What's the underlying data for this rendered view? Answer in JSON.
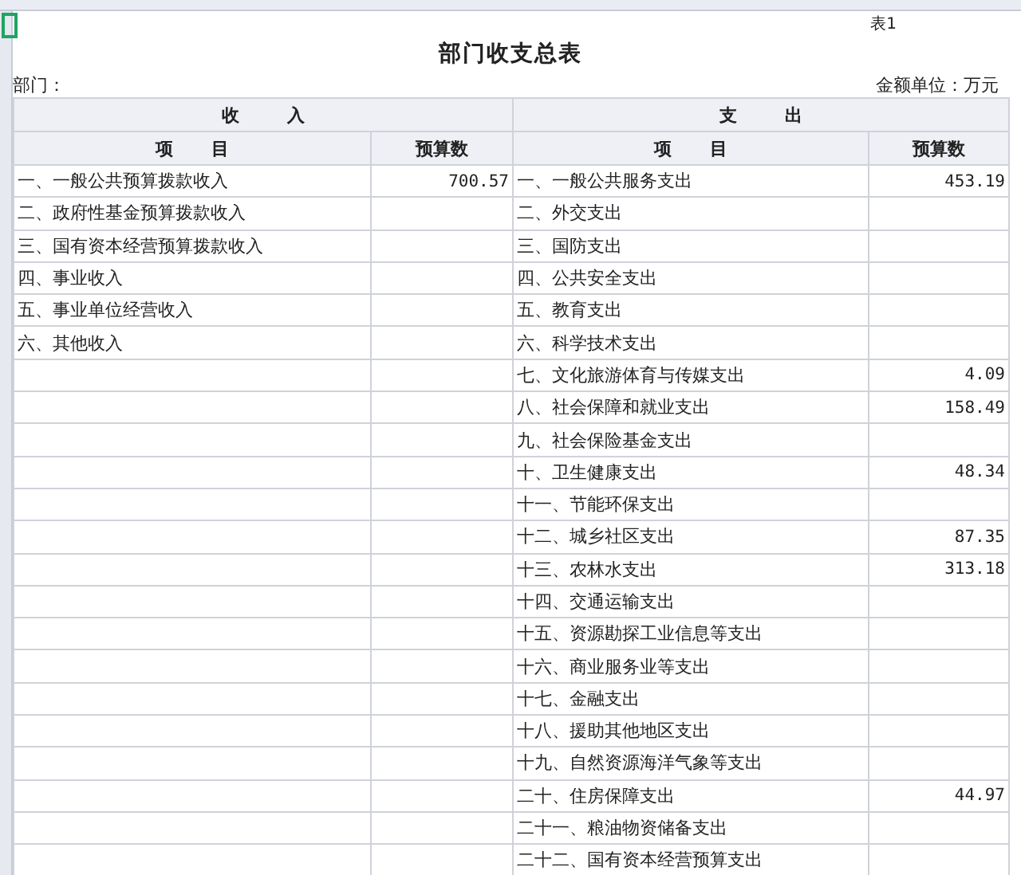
{
  "sheet_label": "表1",
  "title": "部门收支总表",
  "department_label": "部门：",
  "unit_label": "金额单位：万元",
  "group_headers": [
    "收入",
    "支出"
  ],
  "column_headers": [
    "项目",
    "预算数",
    "项目",
    "预算数"
  ],
  "income_rows": [
    {
      "item": "一、一般公共预算拨款收入",
      "amount": "700.57"
    },
    {
      "item": "二、政府性基金预算拨款收入"
    },
    {
      "item": "三、国有资本经营预算拨款收入"
    },
    {
      "item": "四、事业收入"
    },
    {
      "item": "五、事业单位经营收入"
    },
    {
      "item": "六、其他收入"
    }
  ],
  "expense_rows": [
    {
      "item": "一、一般公共服务支出",
      "amount": "453.19"
    },
    {
      "item": "二、外交支出"
    },
    {
      "item": "三、国防支出"
    },
    {
      "item": "四、公共安全支出"
    },
    {
      "item": "五、教育支出"
    },
    {
      "item": "六、科学技术支出"
    },
    {
      "item": "七、文化旅游体育与传媒支出",
      "amount": "4.09"
    },
    {
      "item": "八、社会保障和就业支出",
      "amount": "158.49"
    },
    {
      "item": "九、社会保险基金支出"
    },
    {
      "item": "十、卫生健康支出",
      "amount": "48.34"
    },
    {
      "item": "十一、节能环保支出"
    },
    {
      "item": "十二、城乡社区支出",
      "amount": "87.35"
    },
    {
      "item": "十三、农林水支出",
      "amount": "313.18"
    },
    {
      "item": "十四、交通运输支出"
    },
    {
      "item": "十五、资源勘探工业信息等支出"
    },
    {
      "item": "十六、商业服务业等支出"
    },
    {
      "item": "十七、金融支出"
    },
    {
      "item": "十八、援助其他地区支出"
    },
    {
      "item": "十九、自然资源海洋气象等支出"
    },
    {
      "item": "二十、住房保障支出",
      "amount": "44.97"
    },
    {
      "item": "二十一、粮油物资储备支出"
    },
    {
      "item": "二十二、国有资本经营预算支出"
    }
  ]
}
